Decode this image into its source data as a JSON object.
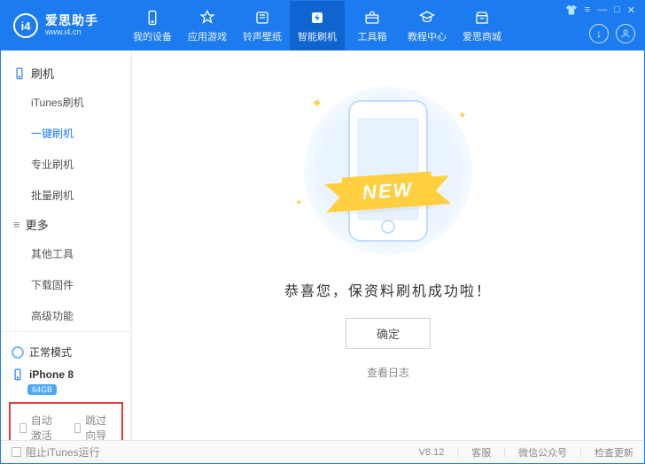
{
  "brand": {
    "logo_text": "i4",
    "title": "爱思助手",
    "sub": "www.i4.cn"
  },
  "tabs": [
    {
      "key": "devices",
      "label": "我的设备"
    },
    {
      "key": "apps",
      "label": "应用游戏"
    },
    {
      "key": "ringtones",
      "label": "铃声壁纸"
    },
    {
      "key": "flash",
      "label": "智能刷机",
      "active": true
    },
    {
      "key": "toolbox",
      "label": "工具箱"
    },
    {
      "key": "tutorial",
      "label": "教程中心"
    },
    {
      "key": "mall",
      "label": "爱思商城"
    }
  ],
  "sidebar": {
    "section1": {
      "title": "刷机",
      "items": [
        {
          "label": "iTunes刷机"
        },
        {
          "label": "一键刷机",
          "active": true
        },
        {
          "label": "专业刷机"
        },
        {
          "label": "批量刷机"
        }
      ]
    },
    "section2": {
      "title": "更多",
      "items": [
        {
          "label": "其他工具"
        },
        {
          "label": "下载固件"
        },
        {
          "label": "高级功能"
        }
      ]
    },
    "mode": "正常模式",
    "device_name": "iPhone 8",
    "device_capacity": "64GB",
    "opt_auto_activate": "自动激活",
    "opt_skip_guide": "跳过向导"
  },
  "main": {
    "ribbon": "NEW",
    "result": "恭喜您，保资料刷机成功啦！",
    "ok": "确定",
    "log": "查看日志"
  },
  "footer": {
    "block_itunes": "阻止iTunes运行",
    "version": "V8.12",
    "support": "客服",
    "wechat": "微信公众号",
    "update": "检查更新"
  }
}
